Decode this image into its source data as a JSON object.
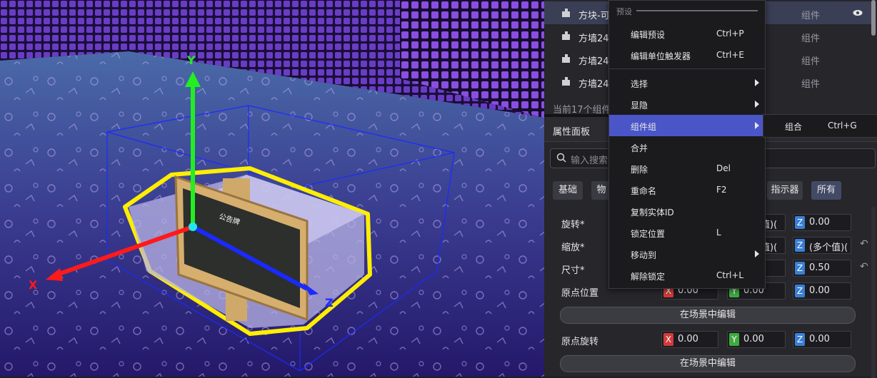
{
  "entity_list": {
    "rows": [
      {
        "name": "方块-可",
        "type": "组件",
        "selected": true
      },
      {
        "name": "方墙24",
        "type": "组件",
        "selected": false
      },
      {
        "name": "方墙24",
        "type": "组件",
        "selected": false
      },
      {
        "name": "方墙24",
        "type": "组件",
        "selected": false
      }
    ],
    "count_text": "当前17个组件"
  },
  "properties": {
    "title": "属性面板",
    "search_placeholder": "输入搜索",
    "tabs": [
      "基础",
      "物",
      "指示器",
      "所有"
    ],
    "rows": {
      "rotation": {
        "label": "旋转*",
        "y": "值)(",
        "z": "0.00"
      },
      "scale": {
        "label": "缩放*",
        "y": "值)(",
        "z": "(多个值)("
      },
      "size": {
        "label": "尺寸*",
        "z": "0.50"
      },
      "origin_pos": {
        "label": "原点位置",
        "x": "0.00",
        "y": "0.00",
        "z": "0.00"
      },
      "origin_rot": {
        "label": "原点旋转",
        "x": "0.00",
        "y": "0.00",
        "z": "0.00"
      }
    },
    "edit_in_scene": "在场景中编辑",
    "axis_labels": {
      "x": "X",
      "y": "Y",
      "z": "Z"
    }
  },
  "context_menu": {
    "header": "预设",
    "items": [
      {
        "label": "编辑预设",
        "shortcut": "Ctrl+P",
        "submenu": false
      },
      {
        "label": "编辑单位触发器",
        "shortcut": "Ctrl+E",
        "submenu": false
      },
      {
        "label": "选择",
        "shortcut": "",
        "submenu": true
      },
      {
        "label": "显隐",
        "shortcut": "",
        "submenu": true
      },
      {
        "label": "组件组",
        "shortcut": "",
        "submenu": true,
        "highlighted": true
      },
      {
        "label": "合并",
        "shortcut": "",
        "submenu": false
      },
      {
        "label": "删除",
        "shortcut": "Del",
        "submenu": false
      },
      {
        "label": "重命名",
        "shortcut": "F2",
        "submenu": false
      },
      {
        "label": "复制实体ID",
        "shortcut": "",
        "submenu": false
      },
      {
        "label": "锁定位置",
        "shortcut": "L",
        "submenu": false
      },
      {
        "label": "移动到",
        "shortcut": "",
        "submenu": true
      },
      {
        "label": "解除锁定",
        "shortcut": "Ctrl+L",
        "submenu": false
      }
    ],
    "submenu": {
      "label": "组合",
      "shortcut": "Ctrl+G"
    }
  },
  "viewport": {
    "sign_text": "公告牌",
    "gizmo": {
      "x": "X",
      "y": "Y",
      "z": "Z"
    }
  },
  "colors": {
    "accent": "#4a56c8",
    "selection_outline": "#ffee00",
    "axis_x": "#ff1a1a",
    "axis_y": "#22ee22",
    "axis_z": "#1a2aff"
  }
}
